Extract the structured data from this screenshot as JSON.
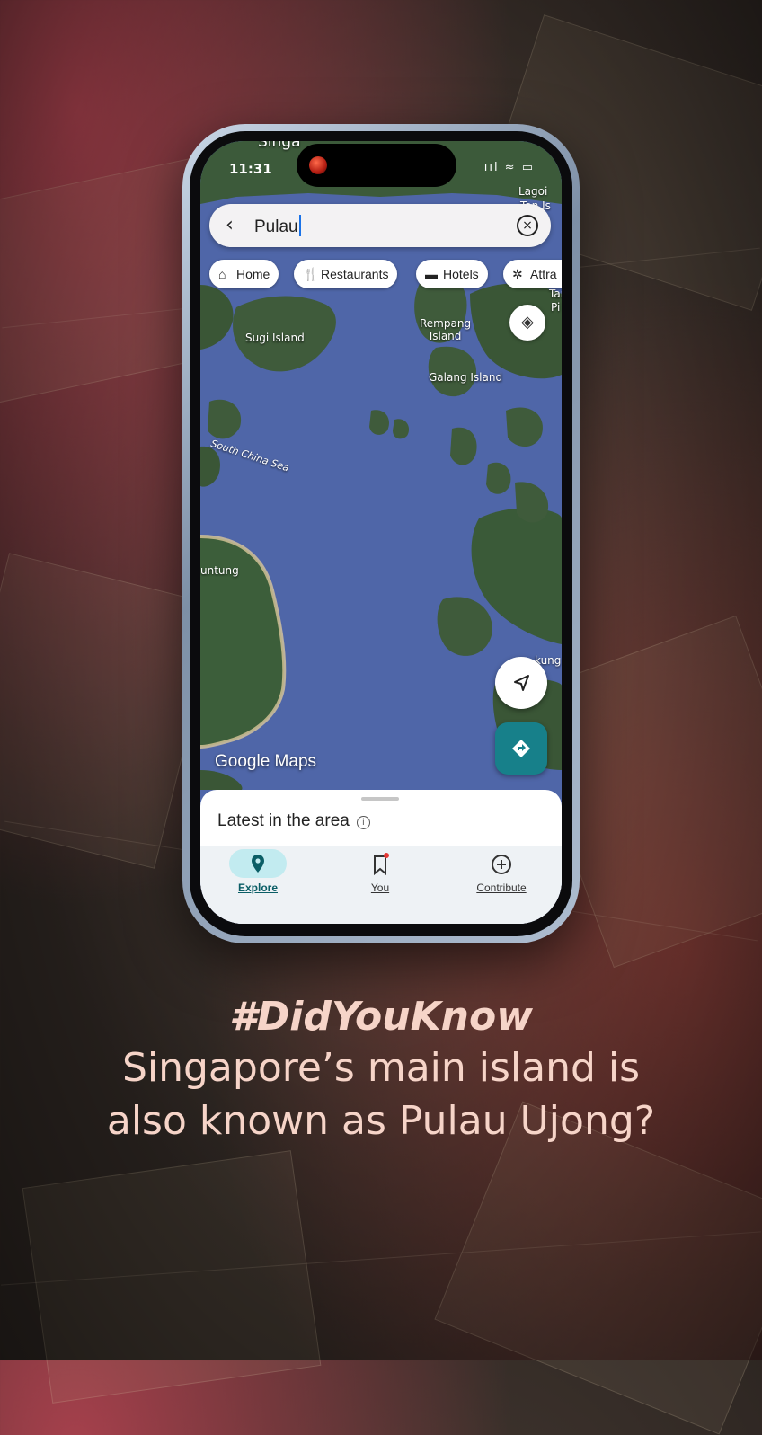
{
  "status": {
    "time": "11:31",
    "right": "ııl ≈ ▭"
  },
  "search": {
    "back_icon": "chevron-left-icon",
    "query": "Pulau",
    "clear_icon": "clear-circle-icon"
  },
  "chips": [
    {
      "label": "Home",
      "icon": "home-icon"
    },
    {
      "label": "Restaurants",
      "icon": "fork-knife-icon"
    },
    {
      "label": "Hotels",
      "icon": "bed-icon"
    },
    {
      "label": "Attra",
      "icon": "attraction-icon"
    }
  ],
  "map_labels": {
    "top_partial": "Singa",
    "lagoi": "Lagoi",
    "sugi": "Sugi Island",
    "rempang": "Rempang\nIsland",
    "galang": "Galang Island",
    "sea": "South China Sea",
    "left_partial": "untung",
    "right_partial": "kung",
    "tan_partial": "Tan",
    "pi_partial": "Pi",
    "tan_is": "Tan Is"
  },
  "watermark": "Google Maps",
  "sheet": {
    "title": "Latest in the area"
  },
  "nav": [
    {
      "label": "Explore",
      "icon": "location-pin-icon",
      "active": true
    },
    {
      "label": "You",
      "icon": "bookmark-icon",
      "active": false
    },
    {
      "label": "Contribute",
      "icon": "add-circle-icon",
      "active": false
    }
  ],
  "caption": {
    "hashtag": "#DidYouKnow",
    "line1": "Singapore’s main island is",
    "line2": "also known as Pulau Ujong?"
  },
  "colors": {
    "accent_teal": "#17808a",
    "caption": "#f6d4c8",
    "sea": "#4f66a8"
  }
}
